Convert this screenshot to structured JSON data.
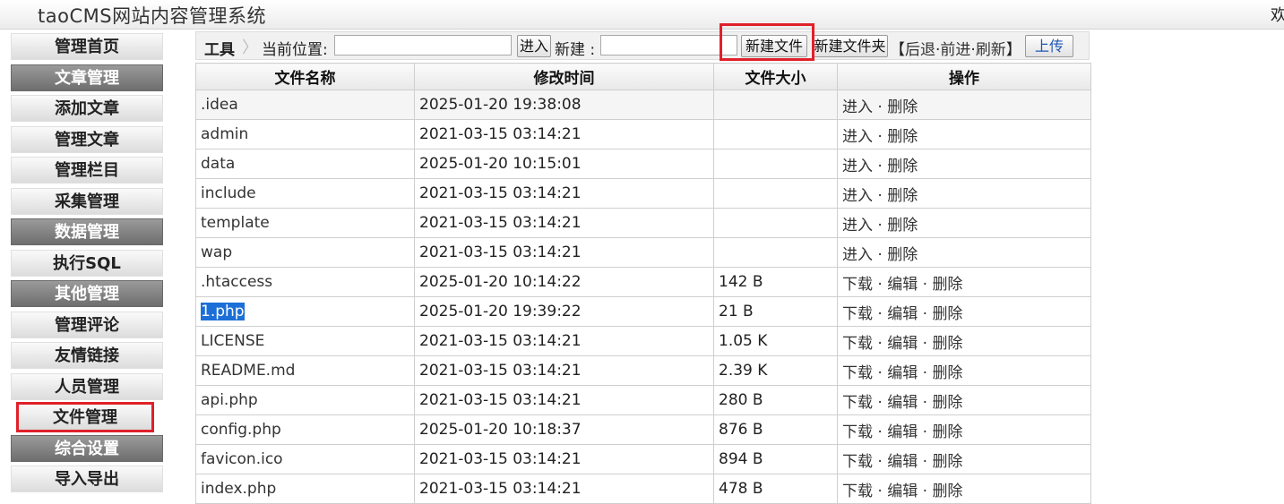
{
  "header": {
    "title": "taoCMS网站内容管理系统",
    "welcome": "欢"
  },
  "sidebar": {
    "items": [
      {
        "label": "管理首页",
        "type": "link"
      },
      {
        "label": "文章管理",
        "type": "category"
      },
      {
        "label": "添加文章",
        "type": "link"
      },
      {
        "label": "管理文章",
        "type": "link"
      },
      {
        "label": "管理栏目",
        "type": "link"
      },
      {
        "label": "采集管理",
        "type": "link"
      },
      {
        "label": "数据管理",
        "type": "category"
      },
      {
        "label": "执行SQL",
        "type": "link"
      },
      {
        "label": "其他管理",
        "type": "category"
      },
      {
        "label": "管理评论",
        "type": "link"
      },
      {
        "label": "友情链接",
        "type": "link"
      },
      {
        "label": "人员管理",
        "type": "link"
      },
      {
        "label": "文件管理",
        "type": "link",
        "active": true
      },
      {
        "label": "综合设置",
        "type": "category"
      },
      {
        "label": "导入导出",
        "type": "link"
      }
    ]
  },
  "toolbar": {
    "tool_label": "工具",
    "location_label": "当前位置:",
    "location_value": "",
    "enter_button": "进入",
    "new_label": "新建 :",
    "new_value": "",
    "new_file_button": "新建文件",
    "new_folder_button": "新建文件夹",
    "nav_bracket_open": "【",
    "back": "后退",
    "dot1": "·",
    "forward": "前进",
    "dot2": "·",
    "refresh": "刷新",
    "nav_bracket_close": "】",
    "upload_button": "上传"
  },
  "table": {
    "headers": [
      "文件名称",
      "修改时间",
      "文件大小",
      "操作"
    ],
    "rows": [
      {
        "name": ".idea",
        "mtime": "2025-01-20 19:38:08",
        "size": "",
        "kind": "dir"
      },
      {
        "name": "admin",
        "mtime": "2021-03-15 03:14:21",
        "size": "",
        "kind": "dir"
      },
      {
        "name": "data",
        "mtime": "2025-01-20 10:15:01",
        "size": "",
        "kind": "dir"
      },
      {
        "name": "include",
        "mtime": "2021-03-15 03:14:21",
        "size": "",
        "kind": "dir"
      },
      {
        "name": "template",
        "mtime": "2021-03-15 03:14:21",
        "size": "",
        "kind": "dir"
      },
      {
        "name": "wap",
        "mtime": "2021-03-15 03:14:21",
        "size": "",
        "kind": "dir"
      },
      {
        "name": ".htaccess",
        "mtime": "2025-01-20 10:14:22",
        "size": "142 B",
        "kind": "file"
      },
      {
        "name": "1.php",
        "mtime": "2025-01-20 19:39:22",
        "size": "21 B",
        "kind": "file",
        "selected": true
      },
      {
        "name": "LICENSE",
        "mtime": "2021-03-15 03:14:21",
        "size": "1.05 K",
        "kind": "file"
      },
      {
        "name": "README.md",
        "mtime": "2021-03-15 03:14:21",
        "size": "2.39 K",
        "kind": "file"
      },
      {
        "name": "api.php",
        "mtime": "2021-03-15 03:14:21",
        "size": "280 B",
        "kind": "file"
      },
      {
        "name": "config.php",
        "mtime": "2025-01-20 10:18:37",
        "size": "876 B",
        "kind": "file"
      },
      {
        "name": "favicon.ico",
        "mtime": "2021-03-15 03:14:21",
        "size": "894 B",
        "kind": "file"
      },
      {
        "name": "index.php",
        "mtime": "2021-03-15 03:14:21",
        "size": "478 B",
        "kind": "file"
      }
    ],
    "ops": {
      "enter": "进入",
      "delete": "删除",
      "download": "下载",
      "edit": "编辑",
      "separator": "·"
    }
  },
  "colors": {
    "highlight_box": "#e0202a",
    "selection": "#1c6fd6",
    "category_bg": "#7a7a7a"
  }
}
